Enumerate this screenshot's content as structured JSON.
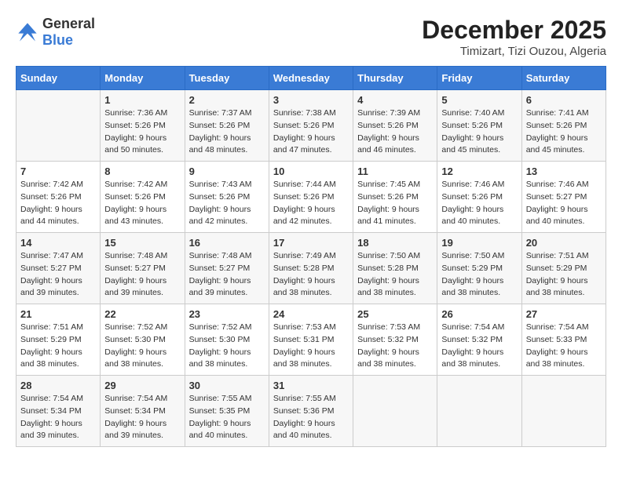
{
  "header": {
    "logo_general": "General",
    "logo_blue": "Blue",
    "month": "December 2025",
    "location": "Timizart, Tizi Ouzou, Algeria"
  },
  "days_of_week": [
    "Sunday",
    "Monday",
    "Tuesday",
    "Wednesday",
    "Thursday",
    "Friday",
    "Saturday"
  ],
  "weeks": [
    [
      {
        "day": "",
        "detail": ""
      },
      {
        "day": "1",
        "detail": "Sunrise: 7:36 AM\nSunset: 5:26 PM\nDaylight: 9 hours\nand 50 minutes."
      },
      {
        "day": "2",
        "detail": "Sunrise: 7:37 AM\nSunset: 5:26 PM\nDaylight: 9 hours\nand 48 minutes."
      },
      {
        "day": "3",
        "detail": "Sunrise: 7:38 AM\nSunset: 5:26 PM\nDaylight: 9 hours\nand 47 minutes."
      },
      {
        "day": "4",
        "detail": "Sunrise: 7:39 AM\nSunset: 5:26 PM\nDaylight: 9 hours\nand 46 minutes."
      },
      {
        "day": "5",
        "detail": "Sunrise: 7:40 AM\nSunset: 5:26 PM\nDaylight: 9 hours\nand 45 minutes."
      },
      {
        "day": "6",
        "detail": "Sunrise: 7:41 AM\nSunset: 5:26 PM\nDaylight: 9 hours\nand 45 minutes."
      }
    ],
    [
      {
        "day": "7",
        "detail": "Sunrise: 7:42 AM\nSunset: 5:26 PM\nDaylight: 9 hours\nand 44 minutes."
      },
      {
        "day": "8",
        "detail": "Sunrise: 7:42 AM\nSunset: 5:26 PM\nDaylight: 9 hours\nand 43 minutes."
      },
      {
        "day": "9",
        "detail": "Sunrise: 7:43 AM\nSunset: 5:26 PM\nDaylight: 9 hours\nand 42 minutes."
      },
      {
        "day": "10",
        "detail": "Sunrise: 7:44 AM\nSunset: 5:26 PM\nDaylight: 9 hours\nand 42 minutes."
      },
      {
        "day": "11",
        "detail": "Sunrise: 7:45 AM\nSunset: 5:26 PM\nDaylight: 9 hours\nand 41 minutes."
      },
      {
        "day": "12",
        "detail": "Sunrise: 7:46 AM\nSunset: 5:26 PM\nDaylight: 9 hours\nand 40 minutes."
      },
      {
        "day": "13",
        "detail": "Sunrise: 7:46 AM\nSunset: 5:27 PM\nDaylight: 9 hours\nand 40 minutes."
      }
    ],
    [
      {
        "day": "14",
        "detail": "Sunrise: 7:47 AM\nSunset: 5:27 PM\nDaylight: 9 hours\nand 39 minutes."
      },
      {
        "day": "15",
        "detail": "Sunrise: 7:48 AM\nSunset: 5:27 PM\nDaylight: 9 hours\nand 39 minutes."
      },
      {
        "day": "16",
        "detail": "Sunrise: 7:48 AM\nSunset: 5:27 PM\nDaylight: 9 hours\nand 39 minutes."
      },
      {
        "day": "17",
        "detail": "Sunrise: 7:49 AM\nSunset: 5:28 PM\nDaylight: 9 hours\nand 38 minutes."
      },
      {
        "day": "18",
        "detail": "Sunrise: 7:50 AM\nSunset: 5:28 PM\nDaylight: 9 hours\nand 38 minutes."
      },
      {
        "day": "19",
        "detail": "Sunrise: 7:50 AM\nSunset: 5:29 PM\nDaylight: 9 hours\nand 38 minutes."
      },
      {
        "day": "20",
        "detail": "Sunrise: 7:51 AM\nSunset: 5:29 PM\nDaylight: 9 hours\nand 38 minutes."
      }
    ],
    [
      {
        "day": "21",
        "detail": "Sunrise: 7:51 AM\nSunset: 5:29 PM\nDaylight: 9 hours\nand 38 minutes."
      },
      {
        "day": "22",
        "detail": "Sunrise: 7:52 AM\nSunset: 5:30 PM\nDaylight: 9 hours\nand 38 minutes."
      },
      {
        "day": "23",
        "detail": "Sunrise: 7:52 AM\nSunset: 5:30 PM\nDaylight: 9 hours\nand 38 minutes."
      },
      {
        "day": "24",
        "detail": "Sunrise: 7:53 AM\nSunset: 5:31 PM\nDaylight: 9 hours\nand 38 minutes."
      },
      {
        "day": "25",
        "detail": "Sunrise: 7:53 AM\nSunset: 5:32 PM\nDaylight: 9 hours\nand 38 minutes."
      },
      {
        "day": "26",
        "detail": "Sunrise: 7:54 AM\nSunset: 5:32 PM\nDaylight: 9 hours\nand 38 minutes."
      },
      {
        "day": "27",
        "detail": "Sunrise: 7:54 AM\nSunset: 5:33 PM\nDaylight: 9 hours\nand 38 minutes."
      }
    ],
    [
      {
        "day": "28",
        "detail": "Sunrise: 7:54 AM\nSunset: 5:34 PM\nDaylight: 9 hours\nand 39 minutes."
      },
      {
        "day": "29",
        "detail": "Sunrise: 7:54 AM\nSunset: 5:34 PM\nDaylight: 9 hours\nand 39 minutes."
      },
      {
        "day": "30",
        "detail": "Sunrise: 7:55 AM\nSunset: 5:35 PM\nDaylight: 9 hours\nand 40 minutes."
      },
      {
        "day": "31",
        "detail": "Sunrise: 7:55 AM\nSunset: 5:36 PM\nDaylight: 9 hours\nand 40 minutes."
      },
      {
        "day": "",
        "detail": ""
      },
      {
        "day": "",
        "detail": ""
      },
      {
        "day": "",
        "detail": ""
      }
    ]
  ]
}
